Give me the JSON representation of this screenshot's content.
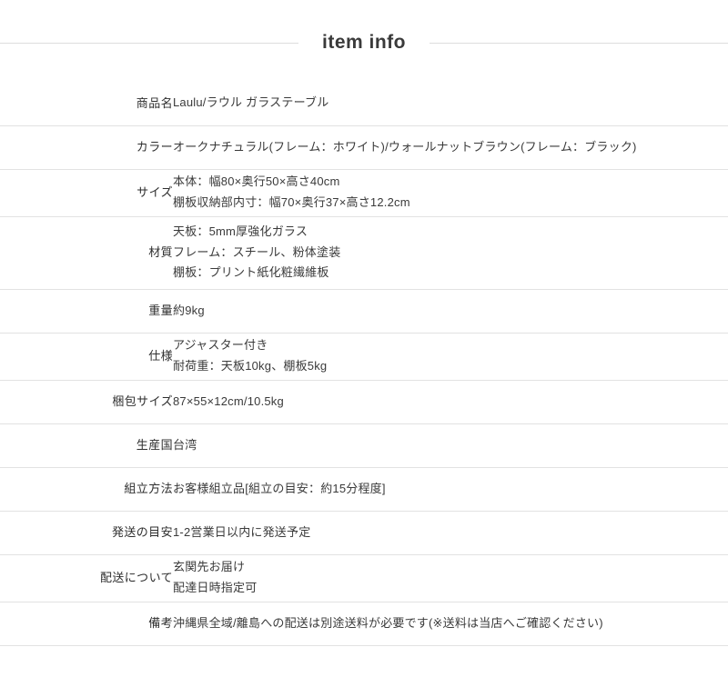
{
  "header": {
    "title": "item info"
  },
  "colors": {
    "rule": "#dddddd",
    "row_border": "#e2e2e2",
    "title_text": "#3a3a3a",
    "label_text": "#2e2e2e",
    "value_text": "#3a3a3a",
    "background": "#ffffff"
  },
  "spec_table": {
    "rows": [
      {
        "label": "商品名",
        "lines": [
          "Laulu/ラウル ガラステーブル"
        ]
      },
      {
        "label": "カラー",
        "lines": [
          "オークナチュラル(フレーム：ホワイト)/ウォールナットブラウン(フレーム：ブラック)"
        ]
      },
      {
        "label": "サイズ",
        "lines": [
          "本体：幅80×奥行50×高さ40cm",
          "棚板収納部内寸：幅70×奥行37×高さ12.2cm"
        ]
      },
      {
        "label": "材質",
        "lines": [
          "天板：5mm厚強化ガラス",
          "フレーム：スチール、粉体塗装",
          "棚板：プリント紙化粧繊維板"
        ]
      },
      {
        "label": "重量",
        "lines": [
          "約9kg"
        ]
      },
      {
        "label": "仕様",
        "lines": [
          "アジャスター付き",
          "耐荷重：天板10kg、棚板5kg"
        ]
      },
      {
        "label": "梱包サイズ",
        "lines": [
          "87×55×12cm/10.5kg"
        ]
      },
      {
        "label": "生産国",
        "lines": [
          "台湾"
        ]
      },
      {
        "label": "組立方法",
        "lines": [
          "お客様組立品[組立の目安：約15分程度]"
        ]
      },
      {
        "label": "発送の目安",
        "lines": [
          "1-2営業日以内に発送予定"
        ]
      },
      {
        "label": "配送について",
        "lines": [
          "玄関先お届け",
          "配達日時指定可"
        ]
      },
      {
        "label": "備考",
        "lines": [
          "沖縄県全域/離島への配送は別途送料が必要です(※送料は当店へご確認ください)"
        ]
      }
    ]
  }
}
